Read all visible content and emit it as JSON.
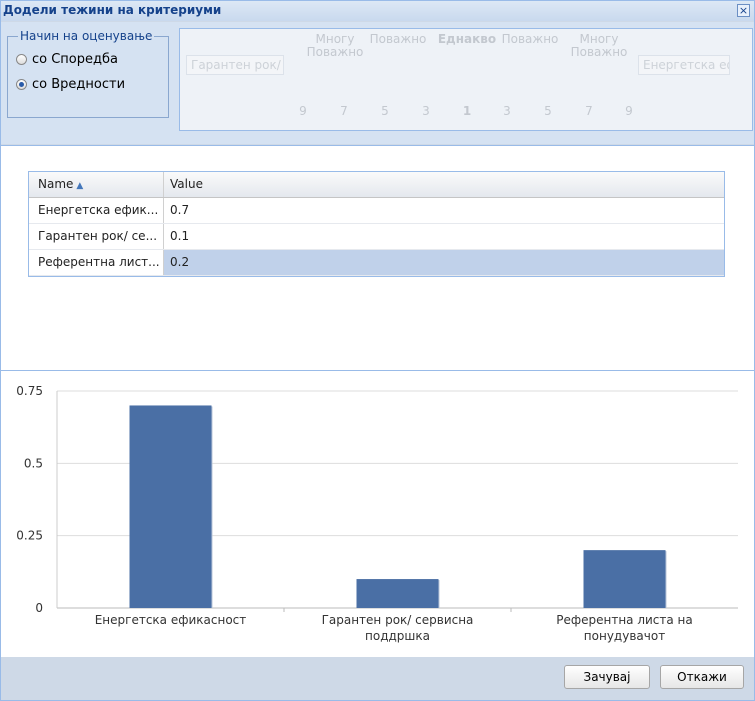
{
  "window": {
    "title": "Додели тежини на критериуми",
    "close_label": "×"
  },
  "rating_mode": {
    "legend": "Начин на оценување",
    "options": [
      {
        "label": "со Споредба",
        "selected": false
      },
      {
        "label": "со Вредности",
        "selected": true
      }
    ]
  },
  "comparison": {
    "left_criterion": "Гарантен рок/",
    "right_criterion": "Енергетска ефи",
    "scale_labels": {
      "much_important_left": "Многу Поважно",
      "important_left": "Поважно",
      "equal": "Еднакво",
      "important_right": "Поважно",
      "much_important_right": "Многу Поважно"
    },
    "scale_numbers": [
      "9",
      "7",
      "5",
      "3",
      "1",
      "3",
      "5",
      "7",
      "9"
    ]
  },
  "grid": {
    "columns": {
      "name": "Name",
      "value": "Value"
    },
    "rows": [
      {
        "name": "Енергетска ефик...",
        "value": "0.7"
      },
      {
        "name": "Гарантен рок/ се...",
        "value": "0.1"
      },
      {
        "name": "Референтна лист...",
        "value": "0.2"
      }
    ]
  },
  "chart_data": {
    "type": "bar",
    "categories": [
      [
        "Енергетска ефикасност"
      ],
      [
        "Гарантен рок/ сервисна",
        "поддршка"
      ],
      [
        "Референтна листа на",
        "понудувачот"
      ]
    ],
    "values": [
      0.7,
      0.1,
      0.2
    ],
    "ylim": [
      0,
      0.75
    ],
    "y_ticks": [
      "0",
      "0.25",
      "0.5",
      "0.75"
    ],
    "y_tick_values": [
      0,
      0.25,
      0.5,
      0.75
    ],
    "grid": true,
    "bar_color": "#4a6fa5"
  },
  "footer": {
    "save_label": "Зачувај",
    "cancel_label": "Откажи"
  }
}
